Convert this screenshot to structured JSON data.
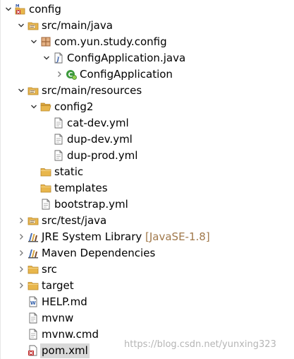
{
  "project_explorer": {
    "rows": [
      {
        "label": "config",
        "depth": 0,
        "state": "expanded",
        "icon": "maven-project-icon"
      },
      {
        "label": "src/main/java",
        "depth": 1,
        "state": "expanded",
        "icon": "source-folder-icon"
      },
      {
        "label": "com.yun.study.config",
        "depth": 2,
        "state": "expanded",
        "icon": "package-icon"
      },
      {
        "label": "ConfigApplication.java",
        "depth": 3,
        "state": "expanded",
        "icon": "java-file-icon"
      },
      {
        "label": "ConfigApplication",
        "depth": 4,
        "state": "collapsed",
        "icon": "spring-class-icon"
      },
      {
        "label": "src/main/resources",
        "depth": 1,
        "state": "expanded",
        "icon": "source-folder-icon"
      },
      {
        "label": "config2",
        "depth": 2,
        "state": "expanded",
        "icon": "folder-open-icon"
      },
      {
        "label": "cat-dev.yml",
        "depth": 3,
        "state": "none",
        "icon": "text-file-icon"
      },
      {
        "label": "dup-dev.yml",
        "depth": 3,
        "state": "none",
        "icon": "text-file-icon"
      },
      {
        "label": "dup-prod.yml",
        "depth": 3,
        "state": "none",
        "icon": "text-file-icon"
      },
      {
        "label": "static",
        "depth": 2,
        "state": "none",
        "icon": "folder-icon"
      },
      {
        "label": "templates",
        "depth": 2,
        "state": "none",
        "icon": "folder-icon"
      },
      {
        "label": "bootstrap.yml",
        "depth": 2,
        "state": "none",
        "icon": "text-file-icon"
      },
      {
        "label": "src/test/java",
        "depth": 1,
        "state": "collapsed",
        "icon": "source-folder-icon"
      },
      {
        "label": "JRE System Library",
        "decoration": "[JavaSE-1.8]",
        "depth": 1,
        "state": "collapsed",
        "icon": "library-icon"
      },
      {
        "label": "Maven Dependencies",
        "depth": 1,
        "state": "collapsed",
        "icon": "library-icon"
      },
      {
        "label": "src",
        "depth": 1,
        "state": "collapsed",
        "icon": "folder-icon"
      },
      {
        "label": "target",
        "depth": 1,
        "state": "collapsed",
        "icon": "folder-icon"
      },
      {
        "label": "HELP.md",
        "depth": 1,
        "state": "none",
        "icon": "markdown-file-icon"
      },
      {
        "label": "mvnw",
        "depth": 1,
        "state": "none",
        "icon": "text-file-icon"
      },
      {
        "label": "mvnw.cmd",
        "depth": 1,
        "state": "none",
        "icon": "text-file-icon"
      },
      {
        "label": "pom.xml",
        "depth": 1,
        "state": "none",
        "icon": "xml-file-icon",
        "selected": true
      }
    ]
  },
  "watermark": "https://blog.csdn.net/yunxing323",
  "colors": {
    "folder": "#e8b64c",
    "folder_dark": "#b8862a",
    "package": "#a0663a",
    "decoration": "#a0784a",
    "selection": "#d9d9d9",
    "spring_green": "#3c9a3c"
  }
}
